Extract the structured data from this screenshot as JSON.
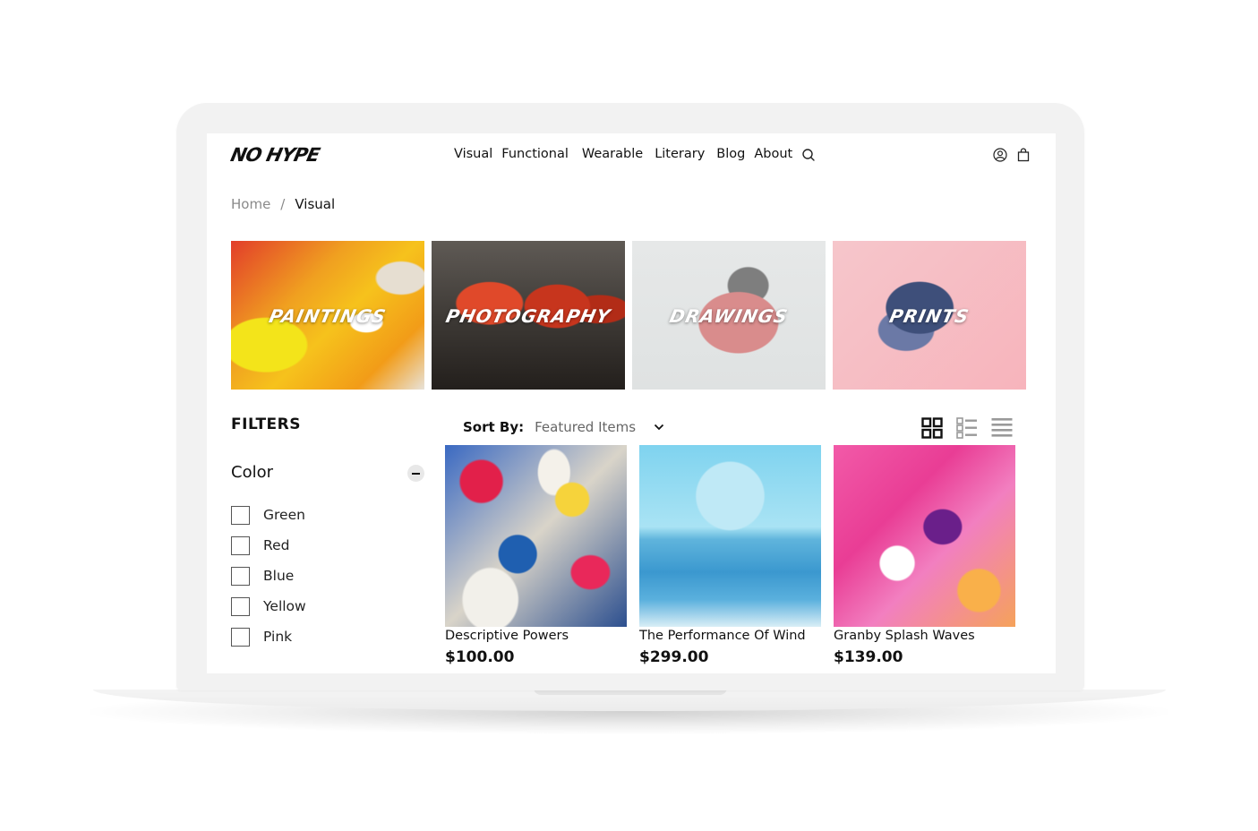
{
  "brand": {
    "logo_text": "NO HYPE"
  },
  "nav": {
    "items": [
      {
        "label": "Visual"
      },
      {
        "label": "Functional"
      },
      {
        "label": "Wearable"
      },
      {
        "label": "Literary"
      },
      {
        "label": "Blog"
      },
      {
        "label": "About"
      }
    ],
    "icons": [
      "search-icon",
      "account-icon",
      "cart-icon"
    ]
  },
  "breadcrumb": {
    "home": "Home",
    "separator": "/",
    "current": "Visual"
  },
  "categories": [
    {
      "label": "PAINTINGS"
    },
    {
      "label": "PHOTOGRAPHY"
    },
    {
      "label": "DRAWINGS"
    },
    {
      "label": "PRINTS"
    }
  ],
  "filters": {
    "title": "FILTERS",
    "group": {
      "name": "Color",
      "options": [
        {
          "label": "Green",
          "checked": false
        },
        {
          "label": "Red",
          "checked": false
        },
        {
          "label": "Blue",
          "checked": false
        },
        {
          "label": "Yellow",
          "checked": false
        },
        {
          "label": "Pink",
          "checked": false
        }
      ]
    }
  },
  "sort": {
    "label": "Sort By:",
    "value": "Featured Items"
  },
  "view_modes": [
    "grid-large-icon",
    "grid-list-icon",
    "list-icon"
  ],
  "products": [
    {
      "title": "Descriptive Powers",
      "price": "$100.00"
    },
    {
      "title": "The Performance Of Wind",
      "price": "$299.00"
    },
    {
      "title": "Granby Splash Waves",
      "price": "$139.00"
    }
  ],
  "colors": {
    "frame": "#f2f2f2",
    "text": "#111111",
    "muted": "#8a8a8a"
  }
}
